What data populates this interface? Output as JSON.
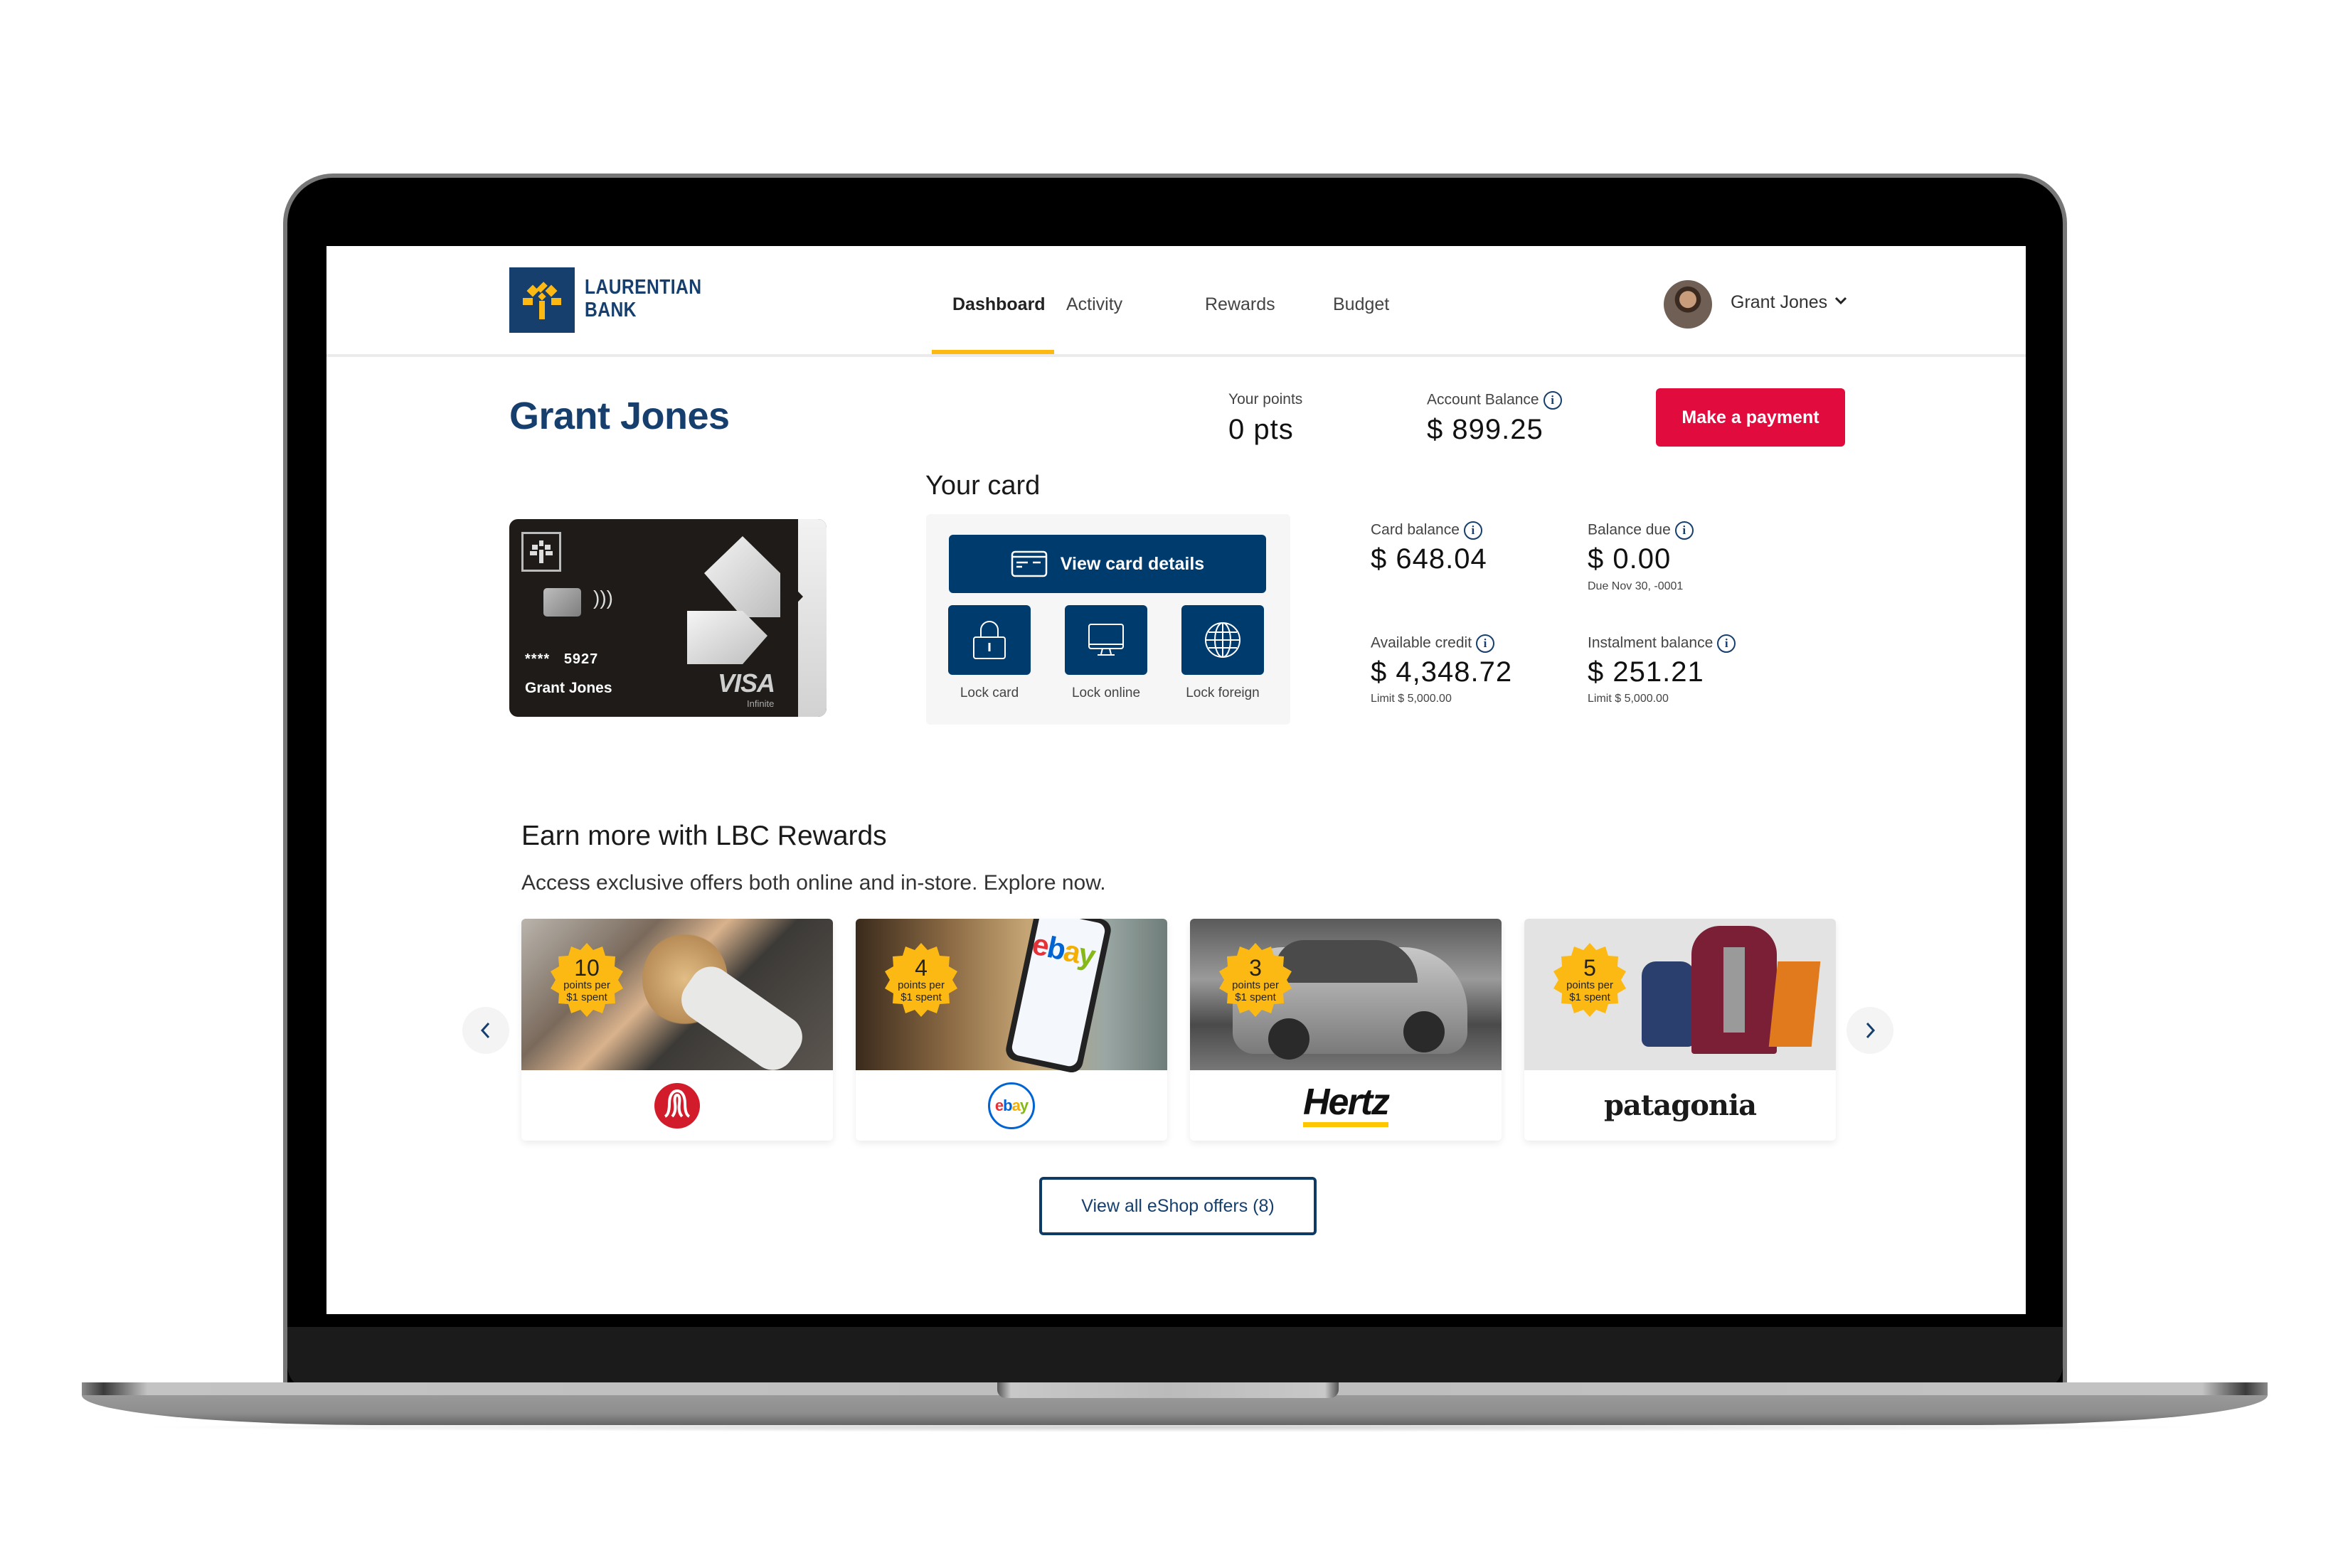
{
  "brand": {
    "name_line1": "LAURENTIAN",
    "name_line2": "BANK",
    "colors": {
      "navy": "#163f6d",
      "button_navy": "#003b6e",
      "gold": "#fdb913",
      "red": "#e20b3d"
    }
  },
  "nav": {
    "items": [
      {
        "label": "Dashboard",
        "active": true
      },
      {
        "label": "Activity",
        "active": false
      },
      {
        "label": "Rewards",
        "active": false
      },
      {
        "label": "Budget",
        "active": false
      }
    ]
  },
  "user": {
    "name": "Grant Jones",
    "avatar_icon": "user-avatar",
    "menu_icon": "chevron-down-icon"
  },
  "summary": {
    "title": "Grant Jones",
    "points_label": "Your points",
    "points_value": "0 pts",
    "balance_label": "Account Balance",
    "balance_value": "$ 899.25",
    "pay_button": "Make a payment"
  },
  "card": {
    "masked": "****",
    "last4": "5927",
    "holder": "Grant Jones",
    "network": "VISA",
    "tier": "Infinite"
  },
  "your_card": {
    "title": "Your card",
    "view_details": "View card details",
    "actions": [
      {
        "label": "Lock card",
        "icon": "lock-icon"
      },
      {
        "label": "Lock online",
        "icon": "monitor-icon"
      },
      {
        "label": "Lock foreign",
        "icon": "globe-icon"
      }
    ]
  },
  "stats": {
    "card_balance": {
      "label": "Card balance",
      "value": "$ 648.04"
    },
    "balance_due": {
      "label": "Balance due",
      "value": "$ 0.00",
      "sub": "Due Nov 30, -0001"
    },
    "available_credit": {
      "label": "Available credit",
      "value": "$ 4,348.72",
      "sub": "Limit $ 5,000.00"
    },
    "instalment_balance": {
      "label": "Instalment balance",
      "value": "$ 251.21",
      "sub": "Limit $ 5,000.00"
    }
  },
  "rewards": {
    "title": "Earn more with LBC Rewards",
    "subtitle": "Access exclusive offers both online and in-store. Explore now.",
    "offers": [
      {
        "merchant": "lululemon",
        "points": "10",
        "points_text": "points per",
        "spent_text": "$1 spent"
      },
      {
        "merchant": "ebay",
        "points": "4",
        "points_text": "points per",
        "spent_text": "$1 spent"
      },
      {
        "merchant": "Hertz",
        "points": "3",
        "points_text": "points per",
        "spent_text": "$1 spent"
      },
      {
        "merchant": "patagonia",
        "points": "5",
        "points_text": "points per",
        "spent_text": "$1 spent"
      }
    ],
    "view_all": "View all eShop offers (8)"
  }
}
